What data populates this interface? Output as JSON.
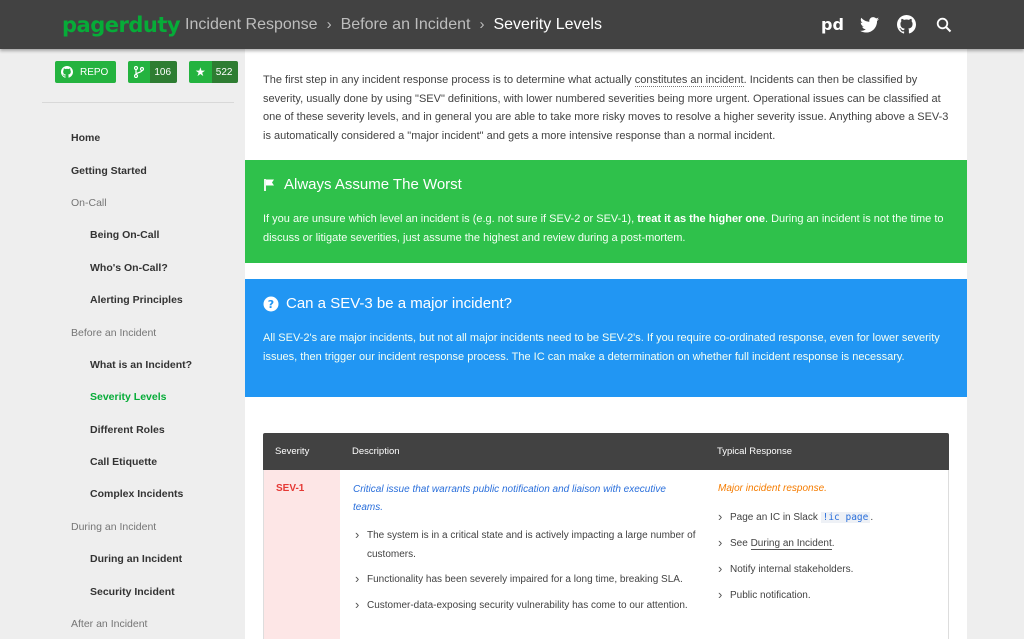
{
  "header": {
    "logo": "pagerduty",
    "breadcrumbs": [
      "Incident Response",
      "Before an Incident",
      "Severity Levels"
    ],
    "pd_icon_text": "pd",
    "icons": [
      "pd-icon",
      "twitter-icon",
      "github-icon",
      "search-icon"
    ],
    "background": "#424242",
    "accent": "#06ac38"
  },
  "sidebar": {
    "badges": {
      "repo_label": "REPO",
      "forks_count": "106",
      "stars_count": "522"
    },
    "nav": [
      {
        "label": "Home",
        "type": "top"
      },
      {
        "label": "Getting Started",
        "type": "top"
      },
      {
        "label": "On-Call",
        "type": "sect"
      },
      {
        "label": "Being On-Call",
        "type": "sub"
      },
      {
        "label": "Who's On-Call?",
        "type": "sub"
      },
      {
        "label": "Alerting Principles",
        "type": "sub"
      },
      {
        "label": "Before an Incident",
        "type": "sect"
      },
      {
        "label": "What is an Incident?",
        "type": "sub"
      },
      {
        "label": "Severity Levels",
        "type": "sub",
        "active": true
      },
      {
        "label": "Different Roles",
        "type": "sub"
      },
      {
        "label": "Call Etiquette",
        "type": "sub"
      },
      {
        "label": "Complex Incidents",
        "type": "sub"
      },
      {
        "label": "During an Incident",
        "type": "sect"
      },
      {
        "label": "During an Incident",
        "type": "sub"
      },
      {
        "label": "Security Incident",
        "type": "sub"
      },
      {
        "label": "After an Incident",
        "type": "sect"
      }
    ]
  },
  "main": {
    "intro": {
      "part1": "The first step in any incident response process is to determine what actually ",
      "link": "constitutes an incident",
      "part2": ". Incidents can then be classified by severity, usually done by using \"SEV\" definitions, with lower numbered severities being more urgent. Operational issues can be classified at one of these severity levels, and in general you are able to take more risky moves to resolve a higher severity issue. Anything above a SEV-3 is automatically considered a \"major incident\" and gets a more intensive response than a normal incident."
    },
    "callout_worst": {
      "title": "Always Assume The Worst",
      "text1": "If you are unsure which level an incident is (e.g. not sure if SEV-2 or SEV-1), ",
      "bold": "treat it as the higher one",
      "text2": ". During an incident is not the time to discuss or litigate severities, just assume the highest and review during a post-mortem.",
      "color": "#2fc14b"
    },
    "callout_sev3": {
      "title": "Can a SEV-3 be a major incident?",
      "text": "All SEV-2's are major incidents, but not all major incidents need to be SEV-2's. If you require co-ordinated response, even for lower severity issues, then trigger our incident response process. The IC can make a determination on whether full incident response is necessary.",
      "color": "#2196f3"
    },
    "table": {
      "headers": [
        "Severity",
        "Description",
        "Typical Response"
      ],
      "rows": [
        {
          "severity": "SEV-1",
          "description_heading": "Critical issue that warrants public notification and liaison with executive teams.",
          "description_items": [
            "The system is in a critical state and is actively impacting a large number of customers.",
            "Functionality has been severely impaired for a long time, breaking SLA.",
            "Customer-data-exposing security vulnerability has come to our attention."
          ],
          "response_heading": "Major incident response.",
          "response_items": {
            "page_prefix": "Page an IC in Slack ",
            "page_code": "!ic page",
            "page_suffix": ".",
            "see_prefix": "See ",
            "see_link": "During an Incident",
            "see_suffix": ".",
            "notify": "Notify internal stakeholders.",
            "public": "Public notification."
          }
        }
      ]
    }
  }
}
